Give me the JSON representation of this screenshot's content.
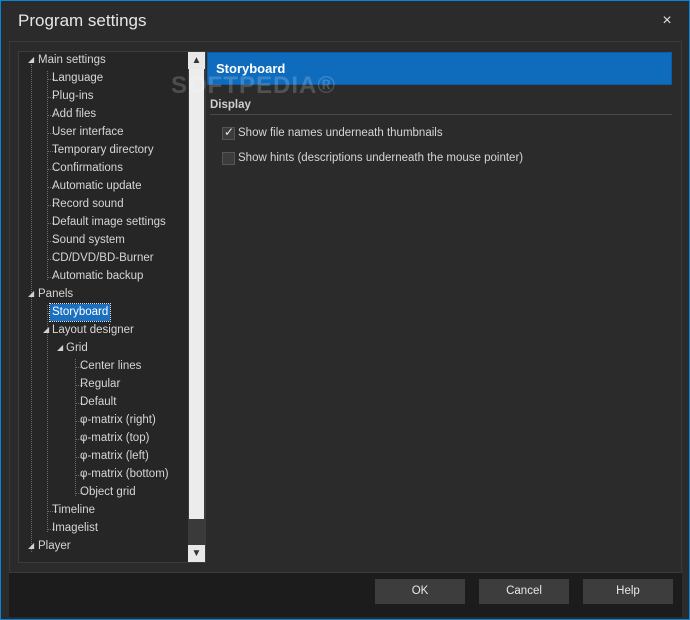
{
  "window": {
    "title": "Program settings",
    "close_glyph": "×"
  },
  "watermark": "SOFTPEDIA®",
  "tree": {
    "items": [
      {
        "label": "Main settings"
      },
      {
        "label": "Language"
      },
      {
        "label": "Plug-ins"
      },
      {
        "label": "Add files"
      },
      {
        "label": "User interface"
      },
      {
        "label": "Temporary directory"
      },
      {
        "label": "Confirmations"
      },
      {
        "label": "Automatic update"
      },
      {
        "label": "Record sound"
      },
      {
        "label": "Default image settings"
      },
      {
        "label": "Sound system"
      },
      {
        "label": "CD/DVD/BD-Burner"
      },
      {
        "label": "Automatic backup"
      },
      {
        "label": "Panels"
      },
      {
        "label": "Storyboard"
      },
      {
        "label": "Layout designer"
      },
      {
        "label": "Grid"
      },
      {
        "label": "Center lines"
      },
      {
        "label": "Regular"
      },
      {
        "label": "Default"
      },
      {
        "label": "φ-matrix (right)"
      },
      {
        "label": "φ-matrix (top)"
      },
      {
        "label": "φ-matrix (left)"
      },
      {
        "label": "φ-matrix (bottom)"
      },
      {
        "label": "Object grid"
      },
      {
        "label": "Timeline"
      },
      {
        "label": "Imagelist"
      },
      {
        "label": "Player"
      }
    ],
    "selected": "Storyboard",
    "scroll_up": "▲",
    "scroll_down": "▼"
  },
  "panel": {
    "header": "Storyboard",
    "section": "Display",
    "options": [
      {
        "label": "Show file names underneath thumbnails",
        "checked": true
      },
      {
        "label": "Show hints (descriptions underneath the mouse pointer)",
        "checked": false
      }
    ]
  },
  "footer": {
    "ok": "OK",
    "cancel": "Cancel",
    "help": "Help"
  },
  "colors": {
    "accent": "#0f6cbd",
    "border": "#0a84d6"
  }
}
